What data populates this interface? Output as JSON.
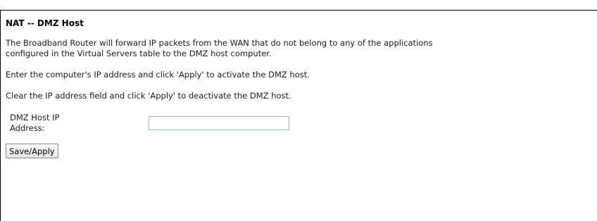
{
  "page": {
    "title": "NAT -- DMZ Host",
    "description_line1": "The Broadband Router will forward IP packets from the WAN that do not belong to any of the applications",
    "description_line2": "configured in the Virtual Servers table to the DMZ host computer.",
    "instruction_activate": "Enter the computer's IP address and click 'Apply' to activate the DMZ host.",
    "instruction_deactivate": "Clear the IP address field and click 'Apply' to deactivate the DMZ host."
  },
  "form": {
    "dmz_host_ip_label_line1": "DMZ Host IP",
    "dmz_host_ip_label_line2": "Address:",
    "dmz_host_ip_value": ""
  },
  "actions": {
    "save_apply_label": "Save/Apply"
  }
}
